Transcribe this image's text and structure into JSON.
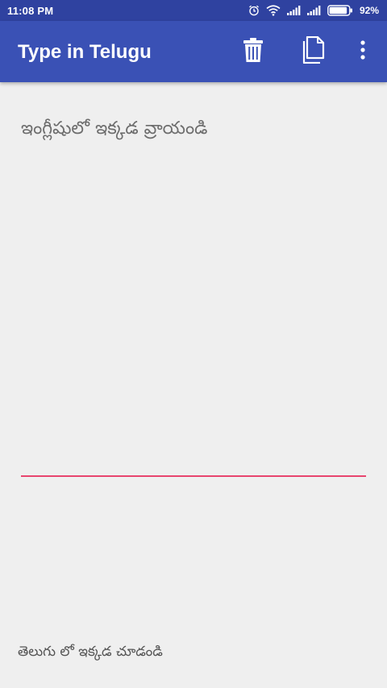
{
  "status_bar": {
    "time": "11:08 PM",
    "battery_percent": "92%",
    "icons": [
      "alarm-icon",
      "wifi-icon",
      "signal-icon",
      "signal-icon",
      "battery-icon"
    ],
    "battery_level": 0.92
  },
  "app_bar": {
    "title": "Type in Telugu",
    "actions": [
      "delete-icon",
      "copy-icon",
      "more-vert-icon"
    ],
    "background": "#3a51b5"
  },
  "input": {
    "placeholder": "ఇంగ్లీషులో ఇక్కడ వ్రాయండి",
    "value": "",
    "underline_color": "#e8456e"
  },
  "output": {
    "hint": "తెలుగు లో ఇక్కడ చూడండి"
  }
}
